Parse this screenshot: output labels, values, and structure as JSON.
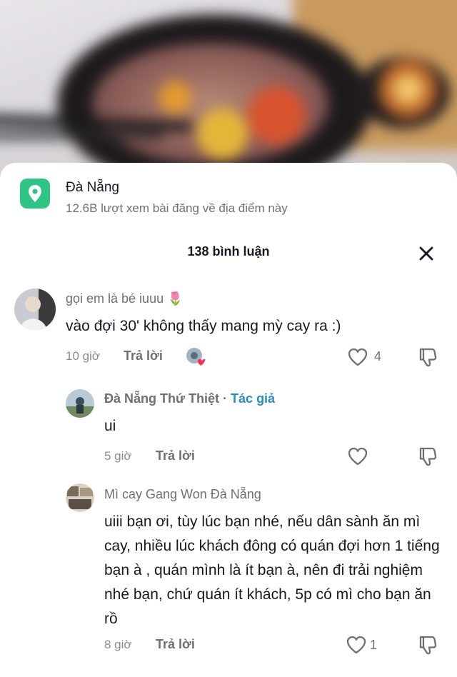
{
  "location": {
    "title": "Đà Nẵng",
    "subtitle": "12.6B lượt xem bài đăng về địa điểm này"
  },
  "header": {
    "count_label": "138 bình luận"
  },
  "comments": [
    {
      "username": "gọi em là bé iuuu 🌷",
      "text": "vào đợi 30' không thấy mang mỳ cay ra :)",
      "time": "10 giờ",
      "reply_label": "Trả lời",
      "likes": "4"
    },
    {
      "username": "Đà Nẵng Thứ Thiệt",
      "separator": " · ",
      "author_badge": "Tác giả",
      "text": "ui",
      "time": "5 giờ",
      "reply_label": "Trả lời",
      "likes": ""
    },
    {
      "username": "Mì cay Gang Won Đà Nẵng",
      "text": "uiii bạn ơi, tùy lúc bạn nhé, nếu dân sành ăn mì cay, nhiều lúc khách đông có quán đợi hơn 1 tiếng bạn à , quán mình là ít bạn à, nên đi trải nghiệm nhé bạn, chứ quán ít khách, 5p có mì cho bạn ăn rồ",
      "time": "8 giờ",
      "reply_label": "Trả lời",
      "likes": "1"
    }
  ],
  "colors": {
    "location_icon_bg": "#2dc486",
    "author_badge": "#2b8cc4"
  }
}
